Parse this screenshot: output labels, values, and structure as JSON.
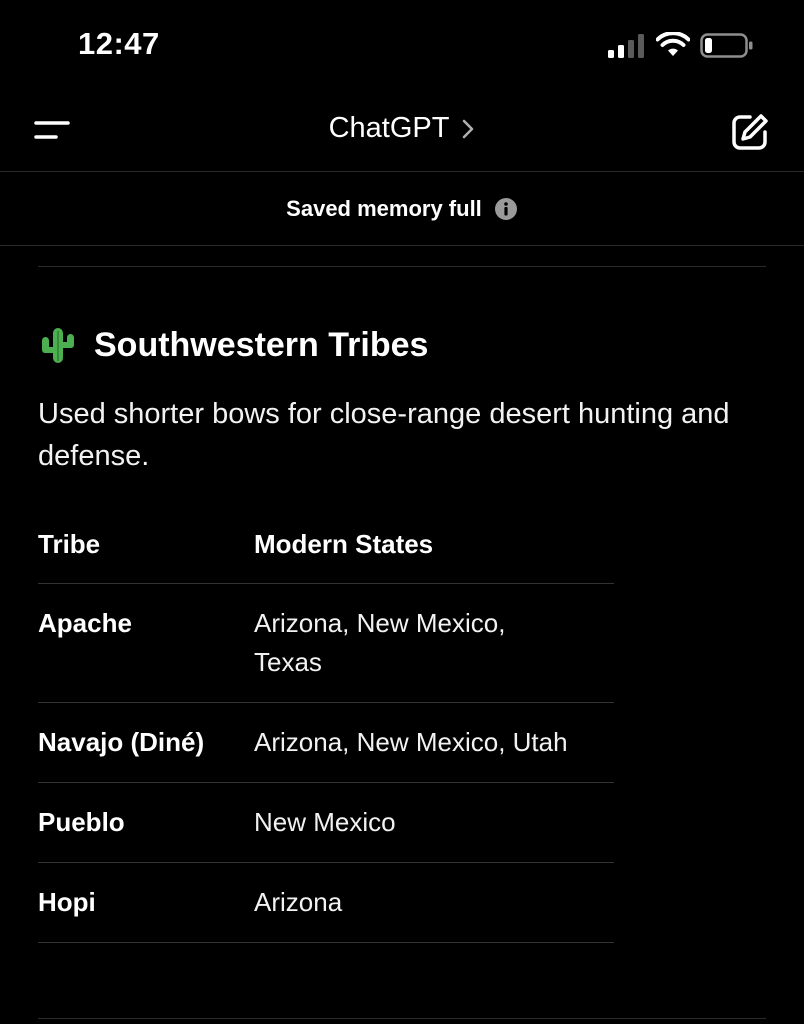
{
  "status_bar": {
    "time": "12:47"
  },
  "nav": {
    "title": "ChatGPT",
    "menu_icon": "menu-icon",
    "compose_icon": "compose-icon"
  },
  "banner": {
    "text": "Saved memory full",
    "icon": "info-icon"
  },
  "section": {
    "emoji_icon": "cactus-icon",
    "title": "Southwestern Tribes",
    "description": "Used shorter bows for close-range desert hunting and defense."
  },
  "table": {
    "headers": [
      "Tribe",
      "Modern States"
    ],
    "rows": [
      {
        "tribe": "Apache",
        "states": "Arizona, New Mexico, Texas"
      },
      {
        "tribe": "Navajo (Diné)",
        "states": "Arizona, New Mexico, Utah"
      },
      {
        "tribe": "Pueblo",
        "states": "New Mexico"
      },
      {
        "tribe": "Hopi",
        "states": "Arizona"
      }
    ]
  }
}
